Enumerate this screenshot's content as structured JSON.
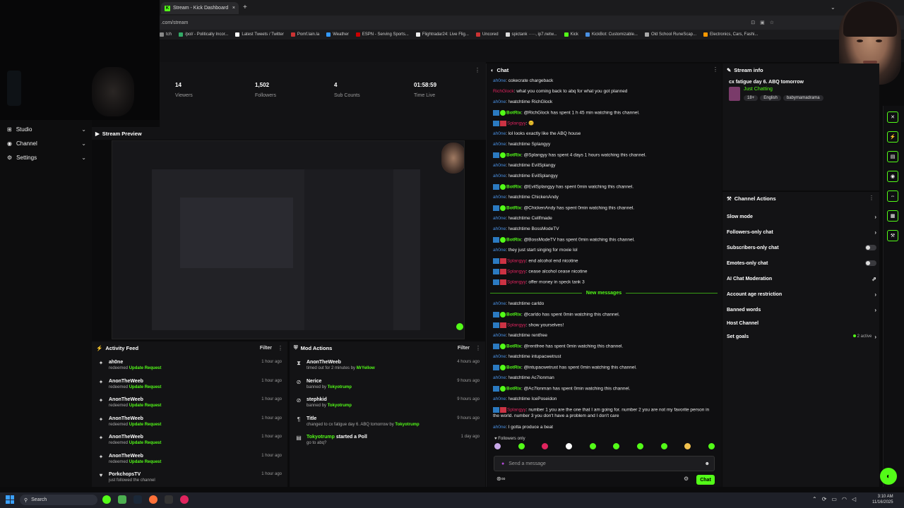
{
  "browser": {
    "tab_title": "Stream - Kick Dashboard",
    "tab_close": "×",
    "new_tab": "+",
    "url": ".com/stream",
    "bookmarks": [
      "tch",
      "/pol/ - Politically Incor...",
      "Latest Tweets / Twitter",
      "Pomf.lain.la",
      "Weather",
      "ESPN - Serving Sports...",
      "Flightradar24: Live Flig...",
      "Uncored",
      "spictank ·····, ip7.netw...",
      "Kick",
      "KickBot: Customizable...",
      "Old School RuneScap...",
      "Electronics, Cars, Fashi..."
    ]
  },
  "sidebar": {
    "items": [
      {
        "label": "Studio",
        "icon": "grid-icon"
      },
      {
        "label": "Channel",
        "icon": "user-icon"
      },
      {
        "label": "Settings",
        "icon": "gear-icon"
      }
    ],
    "chevron": "⌄"
  },
  "stats": [
    {
      "value": "14",
      "label": "Viewers"
    },
    {
      "value": "1,502",
      "label": "Followers"
    },
    {
      "value": "4",
      "label": "Sub Counts"
    },
    {
      "value": "01:58:59",
      "label": "Time Live"
    }
  ],
  "preview": {
    "title": "Stream Preview"
  },
  "activity": {
    "title": "Activity Feed",
    "filter": "Filter",
    "rows": [
      {
        "name": "ah0ne",
        "action": "redeemed",
        "detail": "Update Request",
        "time": "1 hour ago"
      },
      {
        "name": "AnonTheWeeb",
        "action": "redeemed",
        "detail": "Update Request",
        "time": "1 hour ago"
      },
      {
        "name": "AnonTheWeeb",
        "action": "redeemed",
        "detail": "Update Request",
        "time": "1 hour ago"
      },
      {
        "name": "AnonTheWeeb",
        "action": "redeemed",
        "detail": "Update Request",
        "time": "1 hour ago"
      },
      {
        "name": "AnonTheWeeb",
        "action": "redeemed",
        "detail": "Update Request",
        "time": "1 hour ago"
      },
      {
        "name": "AnonTheWeeb",
        "action": "redeemed",
        "detail": "Update Request",
        "time": "1 hour ago"
      },
      {
        "name": "PorkchopsTV",
        "action": "just followed the channel",
        "detail": "",
        "time": "1 hour ago"
      }
    ]
  },
  "mod": {
    "title": "Mod Actions",
    "filter": "Filter",
    "rows": [
      {
        "name": "AnonTheWeeb",
        "action": "timed out for 2 minutes by",
        "by": "MrYellow",
        "time": "4 hours ago",
        "icon": "⧗"
      },
      {
        "name": "Nerice",
        "action": "banned by",
        "by": "Tokyotrump",
        "time": "9 hours ago",
        "icon": "⊘"
      },
      {
        "name": "stephkid",
        "action": "banned by",
        "by": "Tokyotrump",
        "time": "9 hours ago",
        "icon": "⊘"
      },
      {
        "name": "Title",
        "action": "changed to cx fatigue day 6. ABQ tomorrow by",
        "by": "Tokyotrump",
        "time": "9 hours ago",
        "icon": "¶"
      },
      {
        "name": "Tokyotrump",
        "action": "go to abq?",
        "by": "",
        "time": "1 day ago",
        "icon": "▤",
        "started": "started a Poll"
      }
    ]
  },
  "chat": {
    "title": "Chat",
    "new_messages": "New messages",
    "followers_only": "Followers only",
    "placeholder": "Send a message",
    "send": "Chat",
    "messages": [
      {
        "user": "ah0ne",
        "color": "blue",
        "text": ": cokecrate chargeback",
        "badges": ""
      },
      {
        "user": "RichGlock",
        "color": "red",
        "text": ": what you coming back to abq for what you got planned",
        "badges": ""
      },
      {
        "user": "ah0ne",
        "color": "blue",
        "text": ": !watchtime RichGlock",
        "badges": ""
      },
      {
        "user": "BotRix",
        "color": "green",
        "text": ": @RichGlock has spent 1 h 45 min watching this channel.",
        "badges": "bot"
      },
      {
        "user": "Splangyy",
        "color": "red",
        "text": ": 🥴",
        "badges": "sub"
      },
      {
        "user": "ah0ne",
        "color": "blue",
        "text": ": lol looks exactly like the ABQ house",
        "badges": ""
      },
      {
        "user": "ah0ne",
        "color": "blue",
        "text": ": !watchtime Splangyy",
        "badges": ""
      },
      {
        "user": "BotRix",
        "color": "green",
        "text": ": @Splangyy has spent 4 days 1 hours watching this channel.",
        "badges": "bot"
      },
      {
        "user": "ah0ne",
        "color": "blue",
        "text": ": !watchtime EvilSplangy",
        "badges": ""
      },
      {
        "user": "ah0ne",
        "color": "blue",
        "text": ": !watchtime EvilSplangyy",
        "badges": ""
      },
      {
        "user": "BotRix",
        "color": "green",
        "text": ": @EvilSplangyy has spent 0min watching this channel.",
        "badges": "bot"
      },
      {
        "user": "ah0ne",
        "color": "blue",
        "text": ": !watchtime ChickenAndy",
        "badges": ""
      },
      {
        "user": "BotRix",
        "color": "green",
        "text": ": @ChickenAndy has spent 0min watching this channel.",
        "badges": "bot"
      },
      {
        "user": "ah0ne",
        "color": "blue",
        "text": ": !watchtime Cellfmade",
        "badges": ""
      },
      {
        "user": "ah0ne",
        "color": "blue",
        "text": ": !watchtime BossModeTV",
        "badges": ""
      },
      {
        "user": "BotRix",
        "color": "green",
        "text": ": @BossModeTV has spent 0min watching this channel.",
        "badges": "bot"
      },
      {
        "user": "ah0ne",
        "color": "blue",
        "text": ": they just start singing for moxie lol",
        "badges": ""
      },
      {
        "user": "Splangyy",
        "color": "red",
        "text": ": end alcohol end nicotine",
        "badges": "sub"
      },
      {
        "user": "Splangyy",
        "color": "red",
        "text": ": cease alcohol cease nicotine",
        "badges": "sub"
      },
      {
        "user": "Splangyy",
        "color": "red",
        "text": ": offer money in speck tank 3",
        "badges": "sub"
      }
    ],
    "messages_after": [
      {
        "user": "ah0ne",
        "color": "blue",
        "text": ": !watchtime carldo",
        "badges": ""
      },
      {
        "user": "BotRix",
        "color": "green",
        "text": ": @carldo has spent 0min watching this channel.",
        "badges": "bot"
      },
      {
        "user": "Splangyy",
        "color": "red",
        "text": ": show yourselves!",
        "badges": "sub"
      },
      {
        "user": "ah0ne",
        "color": "blue",
        "text": ": !watchtime rentfree",
        "badges": ""
      },
      {
        "user": "BotRix",
        "color": "green",
        "text": ": @rentfree has spent 0min watching this channel.",
        "badges": "bot"
      },
      {
        "user": "ah0ne",
        "color": "blue",
        "text": ": !watchtime intupacwetrust",
        "badges": ""
      },
      {
        "user": "BotRix",
        "color": "green",
        "text": ": @intupacwetrust has spent 0min watching this channel.",
        "badges": "bot"
      },
      {
        "user": "ah0ne",
        "color": "blue",
        "text": ": !watchtime Ac7lonman",
        "badges": ""
      },
      {
        "user": "BotRix",
        "color": "green",
        "text": ": @Ac7lonman has spent 0min watching this channel.",
        "badges": "bot"
      },
      {
        "user": "ah0ne",
        "color": "blue",
        "text": ": !watchtime IcePoseidon",
        "badges": ""
      },
      {
        "user": "Splangyy",
        "color": "red",
        "text": ": number 1 you are the one that I am going for. number 2 you are not my favorite person in the world. number 3 you don't have a problem and I don't care",
        "badges": "sub"
      },
      {
        "user": "ah0ne",
        "color": "blue",
        "text": ": I gotta produce a beat",
        "badges": ""
      }
    ]
  },
  "stream_info": {
    "title": "Stream info",
    "stream_title": "cx fatigue day 6. ABQ tomorrow",
    "category": "Just Chatting",
    "tags": [
      "18+",
      "English",
      "babymamadrama"
    ]
  },
  "channel_actions": {
    "title": "Channel Actions",
    "items": [
      {
        "label": "Slow mode",
        "control": "chevron"
      },
      {
        "label": "Followers-only chat",
        "control": "chevron"
      },
      {
        "label": "Subscribers-only chat",
        "control": "toggle"
      },
      {
        "label": "Emotes-only chat",
        "control": "toggle"
      },
      {
        "label": "AI Chat Moderation",
        "control": "external"
      },
      {
        "label": "Account age restriction",
        "control": "chevron"
      },
      {
        "label": "Banned words",
        "control": "chevron"
      },
      {
        "label": "Host Channel",
        "control": "none"
      },
      {
        "label": "Set goals",
        "control": "chevron",
        "status": "2 active"
      }
    ]
  },
  "taskbar": {
    "search": "Search",
    "time": "3:10 AM",
    "date": "11/16/2025"
  },
  "colors": {
    "accent": "#53fc18",
    "user_blue": "#4a90e2",
    "user_red": "#e0245e"
  }
}
